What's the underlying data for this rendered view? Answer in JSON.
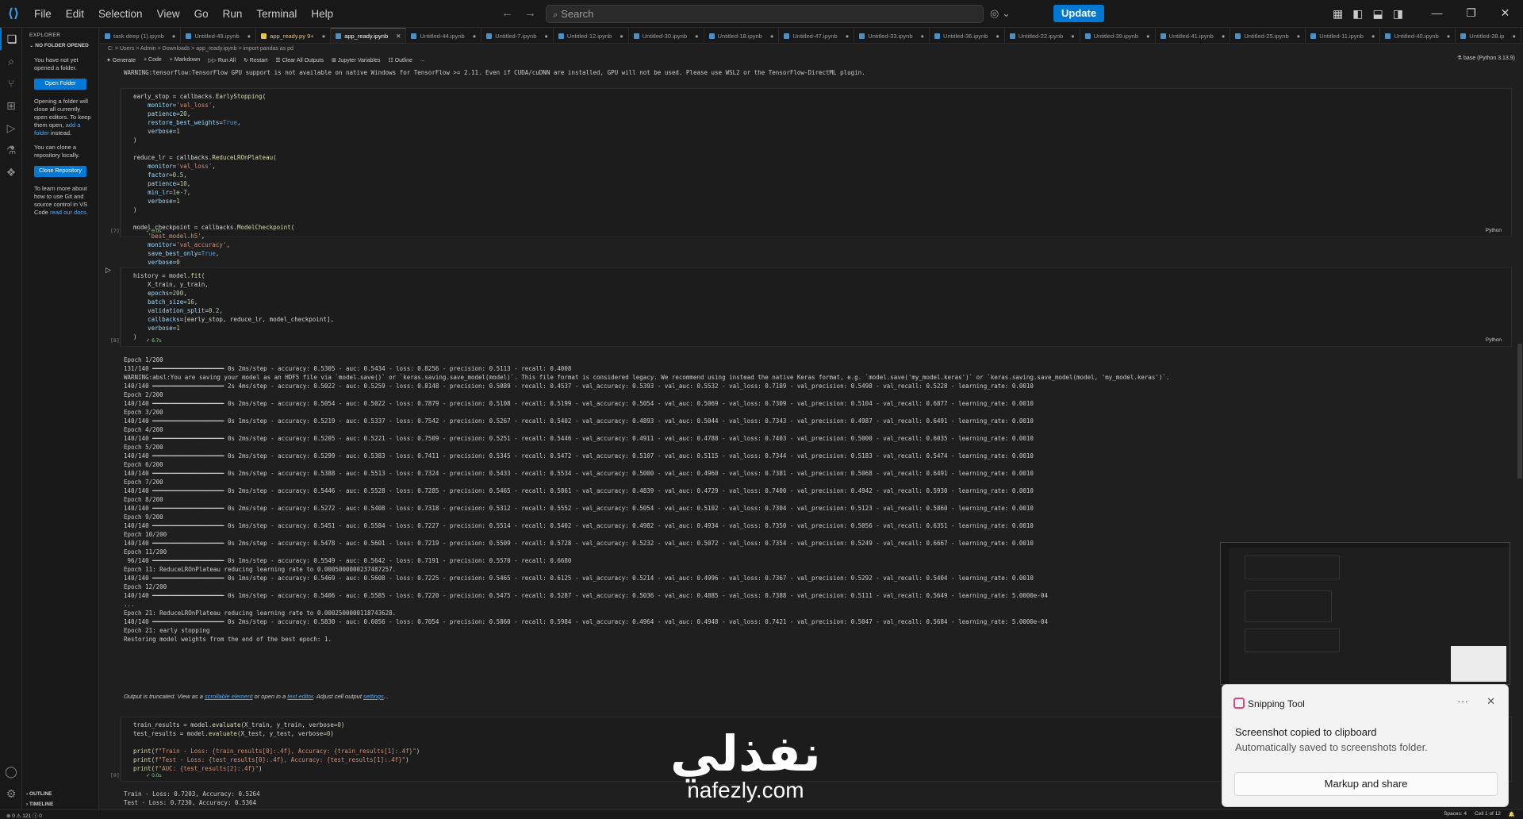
{
  "menu": [
    "File",
    "Edit",
    "Selection",
    "View",
    "Go",
    "Run",
    "Terminal",
    "Help"
  ],
  "search": {
    "placeholder": "Search"
  },
  "update_label": "Update",
  "sidebar": {
    "title": "EXPLORER",
    "section": "NO FOLDER OPENED",
    "p1": "You have not yet opened a folder.",
    "open_folder": "Open Folder",
    "p2_a": "Opening a folder will close all currently open editors. To keep them open,",
    "p2_link1": "add a folder",
    "p2_b": "instead.",
    "p3": "You can clone a repository locally.",
    "clone": "Clone Repository",
    "p4_a": "To learn more about how to use Git and source control in VS Code",
    "p4_link": "read our docs",
    "p4_b": ".",
    "outline": "OUTLINE",
    "timeline": "TIMELINE"
  },
  "tabs": [
    {
      "label": "task deep (1).ipynb",
      "kind": "nb"
    },
    {
      "label": "Untitled-49.ipynb",
      "kind": "nb"
    },
    {
      "label": "app_ready.py 9+",
      "kind": "py"
    },
    {
      "label": "app_ready.ipynb",
      "kind": "nb",
      "active": true
    },
    {
      "label": "Untitled-44.ipynb",
      "kind": "nb"
    },
    {
      "label": "Untitled-7.ipynb",
      "kind": "nb"
    },
    {
      "label": "Untitled-12.ipynb",
      "kind": "nb"
    },
    {
      "label": "Untitled-30.ipynb",
      "kind": "nb"
    },
    {
      "label": "Untitled-18.ipynb",
      "kind": "nb"
    },
    {
      "label": "Untitled-47.ipynb",
      "kind": "nb"
    },
    {
      "label": "Untitled-33.ipynb",
      "kind": "nb"
    },
    {
      "label": "Untitled-36.ipynb",
      "kind": "nb"
    },
    {
      "label": "Untitled-22.ipynb",
      "kind": "nb"
    },
    {
      "label": "Untitled-39.ipynb",
      "kind": "nb"
    },
    {
      "label": "Untitled-41.ipynb",
      "kind": "nb"
    },
    {
      "label": "Untitled-25.ipynb",
      "kind": "nb"
    },
    {
      "label": "Untitled-11.ipynb",
      "kind": "nb"
    },
    {
      "label": "Untitled-40.ipynb",
      "kind": "nb"
    },
    {
      "label": "Untitled-28.ip",
      "kind": "nb"
    }
  ],
  "breadcrumb": "C: > Users > Admin > Downloads > app_ready.ipynb > import pandas as pd",
  "toolbar": [
    "Generate",
    "+ Code",
    "+ Markdown",
    "Run All",
    "Restart",
    "Clear All Outputs",
    "Jupyter Variables",
    "Outline",
    "..."
  ],
  "kernel": "base (Python 3.13.9)",
  "warning": "WARNING:tensorflow:TensorFlow GPU support is not available on native Windows for TensorFlow >= 2.11. Even if CUDA/cuDNN are installed, GPU will not be used. Please use WSL2 or the TensorFlow-DirectML plugin.",
  "cell1": {
    "num": "[7]",
    "time": "0.0s",
    "lang": "Python",
    "lines": [
      "early_stop = callbacks.EarlyStopping(",
      "    monitor='val_loss',",
      "    patience=20,",
      "    restore_best_weights=True,",
      "    verbose=1",
      ")",
      "",
      "reduce_lr = callbacks.ReduceLROnPlateau(",
      "    monitor='val_loss',",
      "    factor=0.5,",
      "    patience=10,",
      "    min_lr=1e-7,",
      "    verbose=1",
      ")",
      "",
      "model_checkpoint = callbacks.ModelCheckpoint(",
      "    'best_model.h5',",
      "    monitor='val_accuracy',",
      "    save_best_only=True,",
      "    verbose=0",
      ")"
    ]
  },
  "cell2": {
    "num": "[8]",
    "time": "6.7s",
    "lang": "Python",
    "lines": [
      "history = model.fit(",
      "    X_train, y_train,",
      "    epochs=200,",
      "    batch_size=16,",
      "    validation_split=0.2,",
      "    callbacks=[early_stop, reduce_lr, model_checkpoint],",
      "    verbose=1",
      ")"
    ]
  },
  "output2": [
    "Epoch 1/200",
    "131/140 ━━━━━━━━━━━━━━━━━━━━ 0s 2ms/step - accuracy: 0.5305 - auc: 0.5434 - loss: 0.8256 - precision: 0.5113 - recall: 0.4008",
    "WARNING:absl:You are saving your model as an HDF5 file via `model.save()` or `keras.saving.save_model(model)`. This file format is considered legacy. We recommend using instead the native Keras format, e.g. `model.save('my_model.keras')` or `keras.saving.save_model(model, 'my_model.keras')`.",
    "140/140 ━━━━━━━━━━━━━━━━━━━━ 2s 4ms/step - accuracy: 0.5022 - auc: 0.5259 - loss: 0.8148 - precision: 0.5089 - recall: 0.4537 - val_accuracy: 0.5393 - val_auc: 0.5532 - val_loss: 0.7189 - val_precision: 0.5498 - val_recall: 0.5228 - learning_rate: 0.0010",
    "Epoch 2/200",
    "140/140 ━━━━━━━━━━━━━━━━━━━━ 0s 2ms/step - accuracy: 0.5054 - auc: 0.5022 - loss: 0.7879 - precision: 0.5108 - recall: 0.5199 - val_accuracy: 0.5054 - val_auc: 0.5069 - val_loss: 0.7309 - val_precision: 0.5104 - val_recall: 0.6877 - learning_rate: 0.0010",
    "Epoch 3/200",
    "140/140 ━━━━━━━━━━━━━━━━━━━━ 0s 1ms/step - accuracy: 0.5219 - auc: 0.5337 - loss: 0.7542 - precision: 0.5267 - recall: 0.5402 - val_accuracy: 0.4893 - val_auc: 0.5044 - val_loss: 0.7343 - val_precision: 0.4987 - val_recall: 0.6491 - learning_rate: 0.0010",
    "Epoch 4/200",
    "140/140 ━━━━━━━━━━━━━━━━━━━━ 0s 2ms/step - accuracy: 0.5205 - auc: 0.5221 - loss: 0.7509 - precision: 0.5251 - recall: 0.5446 - val_accuracy: 0.4911 - val_auc: 0.4788 - val_loss: 0.7403 - val_precision: 0.5000 - val_recall: 0.6035 - learning_rate: 0.0010",
    "Epoch 5/200",
    "140/140 ━━━━━━━━━━━━━━━━━━━━ 0s 2ms/step - accuracy: 0.5299 - auc: 0.5383 - loss: 0.7411 - precision: 0.5345 - recall: 0.5472 - val_accuracy: 0.5107 - val_auc: 0.5115 - val_loss: 0.7344 - val_precision: 0.5183 - val_recall: 0.5474 - learning_rate: 0.0010",
    "Epoch 6/200",
    "140/140 ━━━━━━━━━━━━━━━━━━━━ 0s 2ms/step - accuracy: 0.5388 - auc: 0.5513 - loss: 0.7324 - precision: 0.5433 - recall: 0.5534 - val_accuracy: 0.5000 - val_auc: 0.4960 - val_loss: 0.7381 - val_precision: 0.5068 - val_recall: 0.6491 - learning_rate: 0.0010",
    "Epoch 7/200",
    "140/140 ━━━━━━━━━━━━━━━━━━━━ 0s 2ms/step - accuracy: 0.5446 - auc: 0.5528 - loss: 0.7285 - precision: 0.5465 - recall: 0.5861 - val_accuracy: 0.4839 - val_auc: 0.4729 - val_loss: 0.7400 - val_precision: 0.4942 - val_recall: 0.5930 - learning_rate: 0.0010",
    "Epoch 8/200",
    "140/140 ━━━━━━━━━━━━━━━━━━━━ 0s 2ms/step - accuracy: 0.5272 - auc: 0.5408 - loss: 0.7318 - precision: 0.5312 - recall: 0.5552 - val_accuracy: 0.5054 - val_auc: 0.5102 - val_loss: 0.7304 - val_precision: 0.5123 - val_recall: 0.5860 - learning_rate: 0.0010",
    "Epoch 9/200",
    "140/140 ━━━━━━━━━━━━━━━━━━━━ 0s 1ms/step - accuracy: 0.5451 - auc: 0.5584 - loss: 0.7227 - precision: 0.5514 - recall: 0.5402 - val_accuracy: 0.4982 - val_auc: 0.4934 - val_loss: 0.7350 - val_precision: 0.5056 - val_recall: 0.6351 - learning_rate: 0.0010",
    "Epoch 10/200",
    "140/140 ━━━━━━━━━━━━━━━━━━━━ 0s 2ms/step - accuracy: 0.5478 - auc: 0.5601 - loss: 0.7219 - precision: 0.5509 - recall: 0.5728 - val_accuracy: 0.5232 - val_auc: 0.5072 - val_loss: 0.7354 - val_precision: 0.5249 - val_recall: 0.6667 - learning_rate: 0.0010",
    "Epoch 11/200",
    " 96/140 ━━━━━━━━━━━━━━━━━━━━ 0s 1ms/step - accuracy: 0.5549 - auc: 0.5642 - loss: 0.7191 - precision: 0.5570 - recall: 0.6680",
    "Epoch 11: ReduceLROnPlateau reducing learning rate to 0.0005000000237487257.",
    "140/140 ━━━━━━━━━━━━━━━━━━━━ 0s 1ms/step - accuracy: 0.5469 - auc: 0.5608 - loss: 0.7225 - precision: 0.5465 - recall: 0.6125 - val_accuracy: 0.5214 - val_auc: 0.4996 - val_loss: 0.7367 - val_precision: 0.5292 - val_recall: 0.5404 - learning_rate: 0.0010",
    "Epoch 12/200",
    "140/140 ━━━━━━━━━━━━━━━━━━━━ 0s 1ms/step - accuracy: 0.5406 - auc: 0.5585 - loss: 0.7220 - precision: 0.5475 - recall: 0.5287 - val_accuracy: 0.5036 - val_auc: 0.4885 - val_loss: 0.7388 - val_precision: 0.5111 - val_recall: 0.5649 - learning_rate: 5.0000e-04",
    "...",
    "Epoch 21: ReduceLROnPlateau reducing learning rate to 0.0002500000118743628.",
    "140/140 ━━━━━━━━━━━━━━━━━━━━ 0s 2ms/step - accuracy: 0.5830 - auc: 0.6056 - loss: 0.7054 - precision: 0.5860 - recall: 0.5984 - val_accuracy: 0.4964 - val_auc: 0.4948 - val_loss: 0.7421 - val_precision: 0.5047 - val_recall: 0.5684 - learning_rate: 5.0000e-04",
    "Epoch 21: early stopping",
    "Restoring model weights from the end of the best epoch: 1."
  ],
  "truncated": {
    "a": "Output is truncated. View as a ",
    "l1": "scrollable element",
    "b": " or open in a ",
    "l2": "text editor",
    "c": ". Adjust cell output ",
    "l3": "settings",
    "d": "..."
  },
  "cell3": {
    "num": "[9]",
    "time": "0.0s",
    "lines": [
      "train_results = model.evaluate(X_train, y_train, verbose=0)",
      "test_results = model.evaluate(X_test, y_test, verbose=0)",
      "",
      "print(f\"Train - Loss: {train_results[0]:.4f}, Accuracy: {train_results[1]:.4f}\")",
      "print(f\"Test - Loss: {test_results[0]:.4f}, Accuracy: {test_results[1]:.4f}\")",
      "print(f\"AUC: {test_results[2]:.4f}\")"
    ]
  },
  "output3": [
    "Train - Loss: 0.7203, Accuracy: 0.5264",
    "Test - Loss: 0.7230, Accuracy: 0.5364"
  ],
  "toast": {
    "app": "Snipping Tool",
    "title": "Screenshot copied to clipboard",
    "subtitle": "Automatically saved to screenshots folder.",
    "button": "Markup and share"
  },
  "watermark": {
    "arabic": "نفذلي",
    "latin": "nafezly.com"
  },
  "statusbar": {
    "left": "⊗ 0 ⚠ 121 ⓘ 0",
    "spaces": "Spaces: 4",
    "cell": "Cell 1 of 12"
  }
}
